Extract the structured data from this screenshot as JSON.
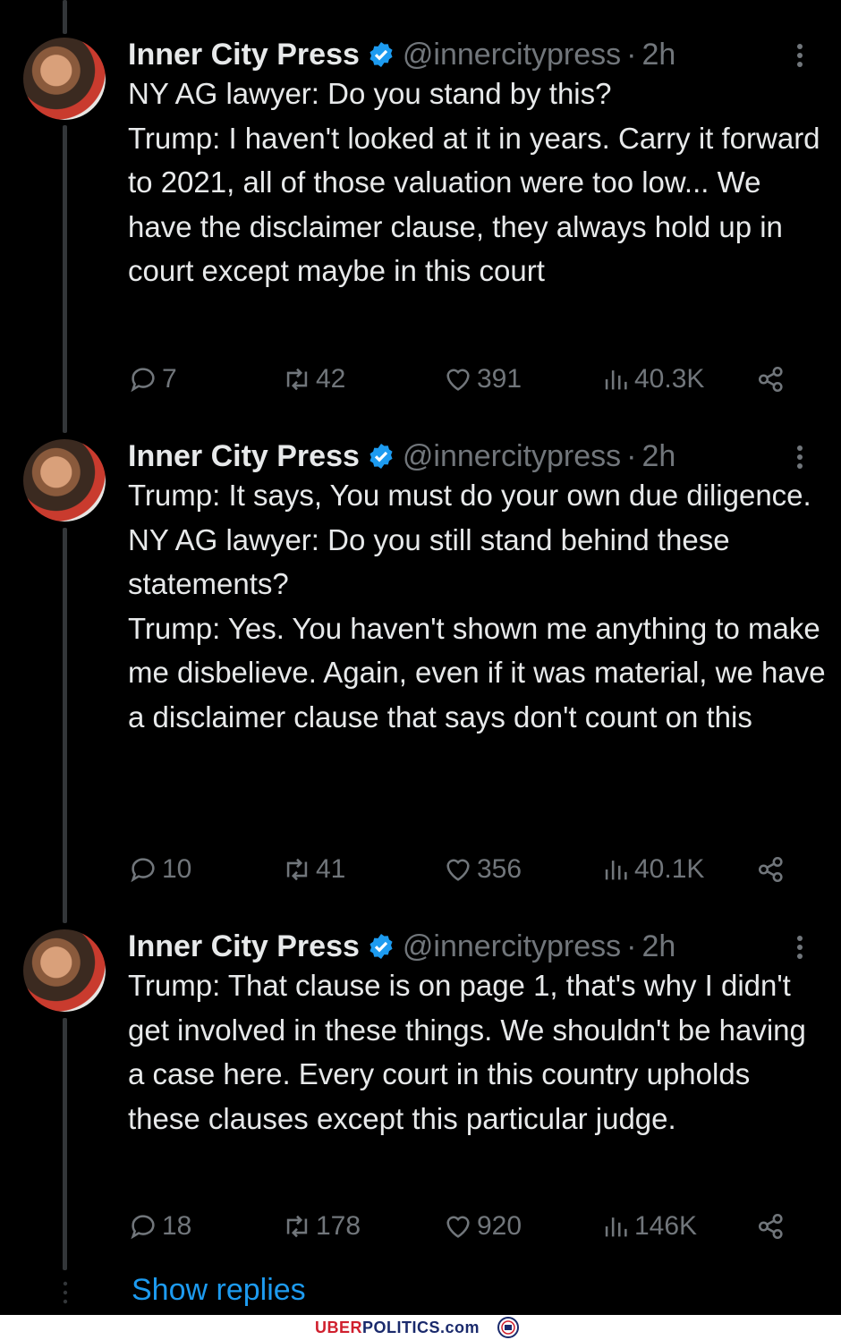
{
  "tweets": [
    {
      "name": "Inner City Press",
      "handle": "@innercitypress",
      "time": "2h",
      "text": "NY AG lawyer: Do you stand by this?\nTrump: I haven't looked at it in years. Carry it forward to 2021, all of those valuation were too low... We have the disclaimer clause, they always hold up in court except maybe in this court",
      "replies": "7",
      "reposts": "42",
      "likes": "391",
      "views": "40.3K"
    },
    {
      "name": "Inner City Press",
      "handle": "@innercitypress",
      "time": "2h",
      "text": "Trump: It says, You must do your own due diligence.\nNY AG lawyer: Do you still stand behind these statements?\nTrump: Yes. You haven't shown me anything to make me disbelieve. Again, even if it was material, we have a disclaimer clause that says don't count on this",
      "replies": "10",
      "reposts": "41",
      "likes": "356",
      "views": "40.1K"
    },
    {
      "name": "Inner City Press",
      "handle": "@innercitypress",
      "time": "2h",
      "text": "Trump: That clause is on page 1, that's why I didn't get involved in these things. We shouldn't be having a case here. Every court in this country upholds these clauses except this particular judge.",
      "replies": "18",
      "reposts": "178",
      "likes": "920",
      "views": "146K"
    }
  ],
  "show_replies": "Show replies",
  "footer": {
    "brand_a": "UBER",
    "brand_b": "POLITICS",
    "brand_c": ".com"
  },
  "colors": {
    "accent": "#1d9bf0",
    "muted": "#71767b",
    "text": "#e7e9ea",
    "bg": "#000000"
  }
}
